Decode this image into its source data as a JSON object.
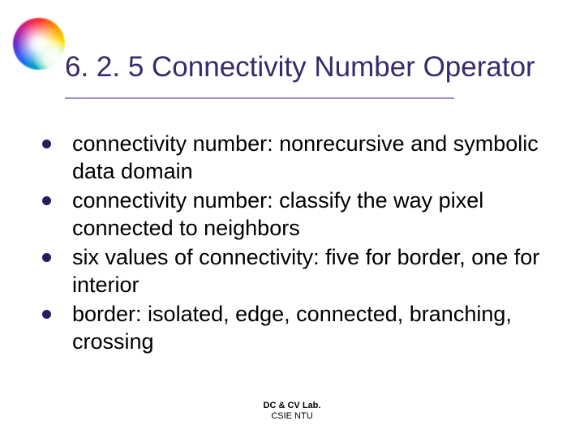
{
  "title": "6. 2. 5 Connectivity Number Operator",
  "bullets": [
    "connectivity number: nonrecursive and symbolic data domain",
    "connectivity number: classify the way pixel connected to neighbors",
    "six values of connectivity: five for border, one for interior",
    "border: isolated, edge, connected, branching, crossing"
  ],
  "footer": {
    "line1": "DC & CV Lab.",
    "line2": "CSIE NTU"
  }
}
